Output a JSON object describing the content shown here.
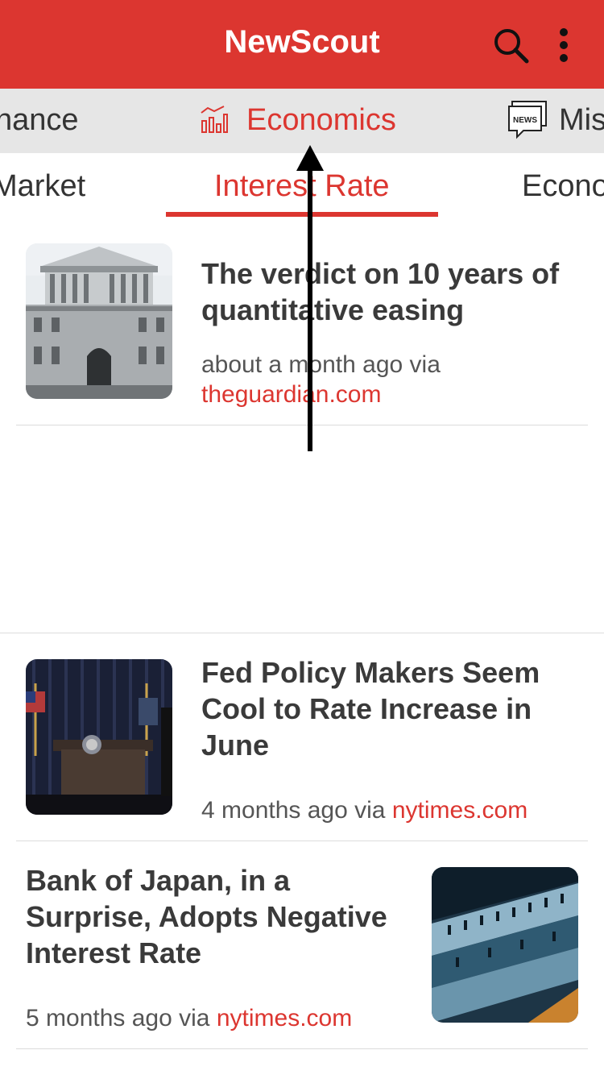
{
  "header": {
    "title": "NewScout"
  },
  "categories": {
    "left": "nance",
    "center": "Economics",
    "right": "Mis",
    "news_icon_text": "NEWS"
  },
  "subcategories": {
    "left": "Market",
    "center": "Interest Rate",
    "right": "Econo"
  },
  "articles": [
    {
      "title_lines": [
        "The verdict on 10 years of",
        "quantitative easing"
      ],
      "time": "about a month ago via",
      "source": "theguardian.com"
    },
    {
      "title_lines": [
        "Fed Policy Makers Seem",
        "Cool to Rate Increase in",
        "June"
      ],
      "time": "4 months ago via",
      "source": "nytimes.com"
    },
    {
      "title_lines": [
        "Bank of Japan, in a",
        "Surprise, Adopts Negative",
        "Interest Rate"
      ],
      "time": "5 months ago via",
      "source": "nytimes.com"
    }
  ],
  "colors": {
    "accent": "#dc3630",
    "header_bg": "#dc3630",
    "category_bg": "#e6e6e6"
  }
}
